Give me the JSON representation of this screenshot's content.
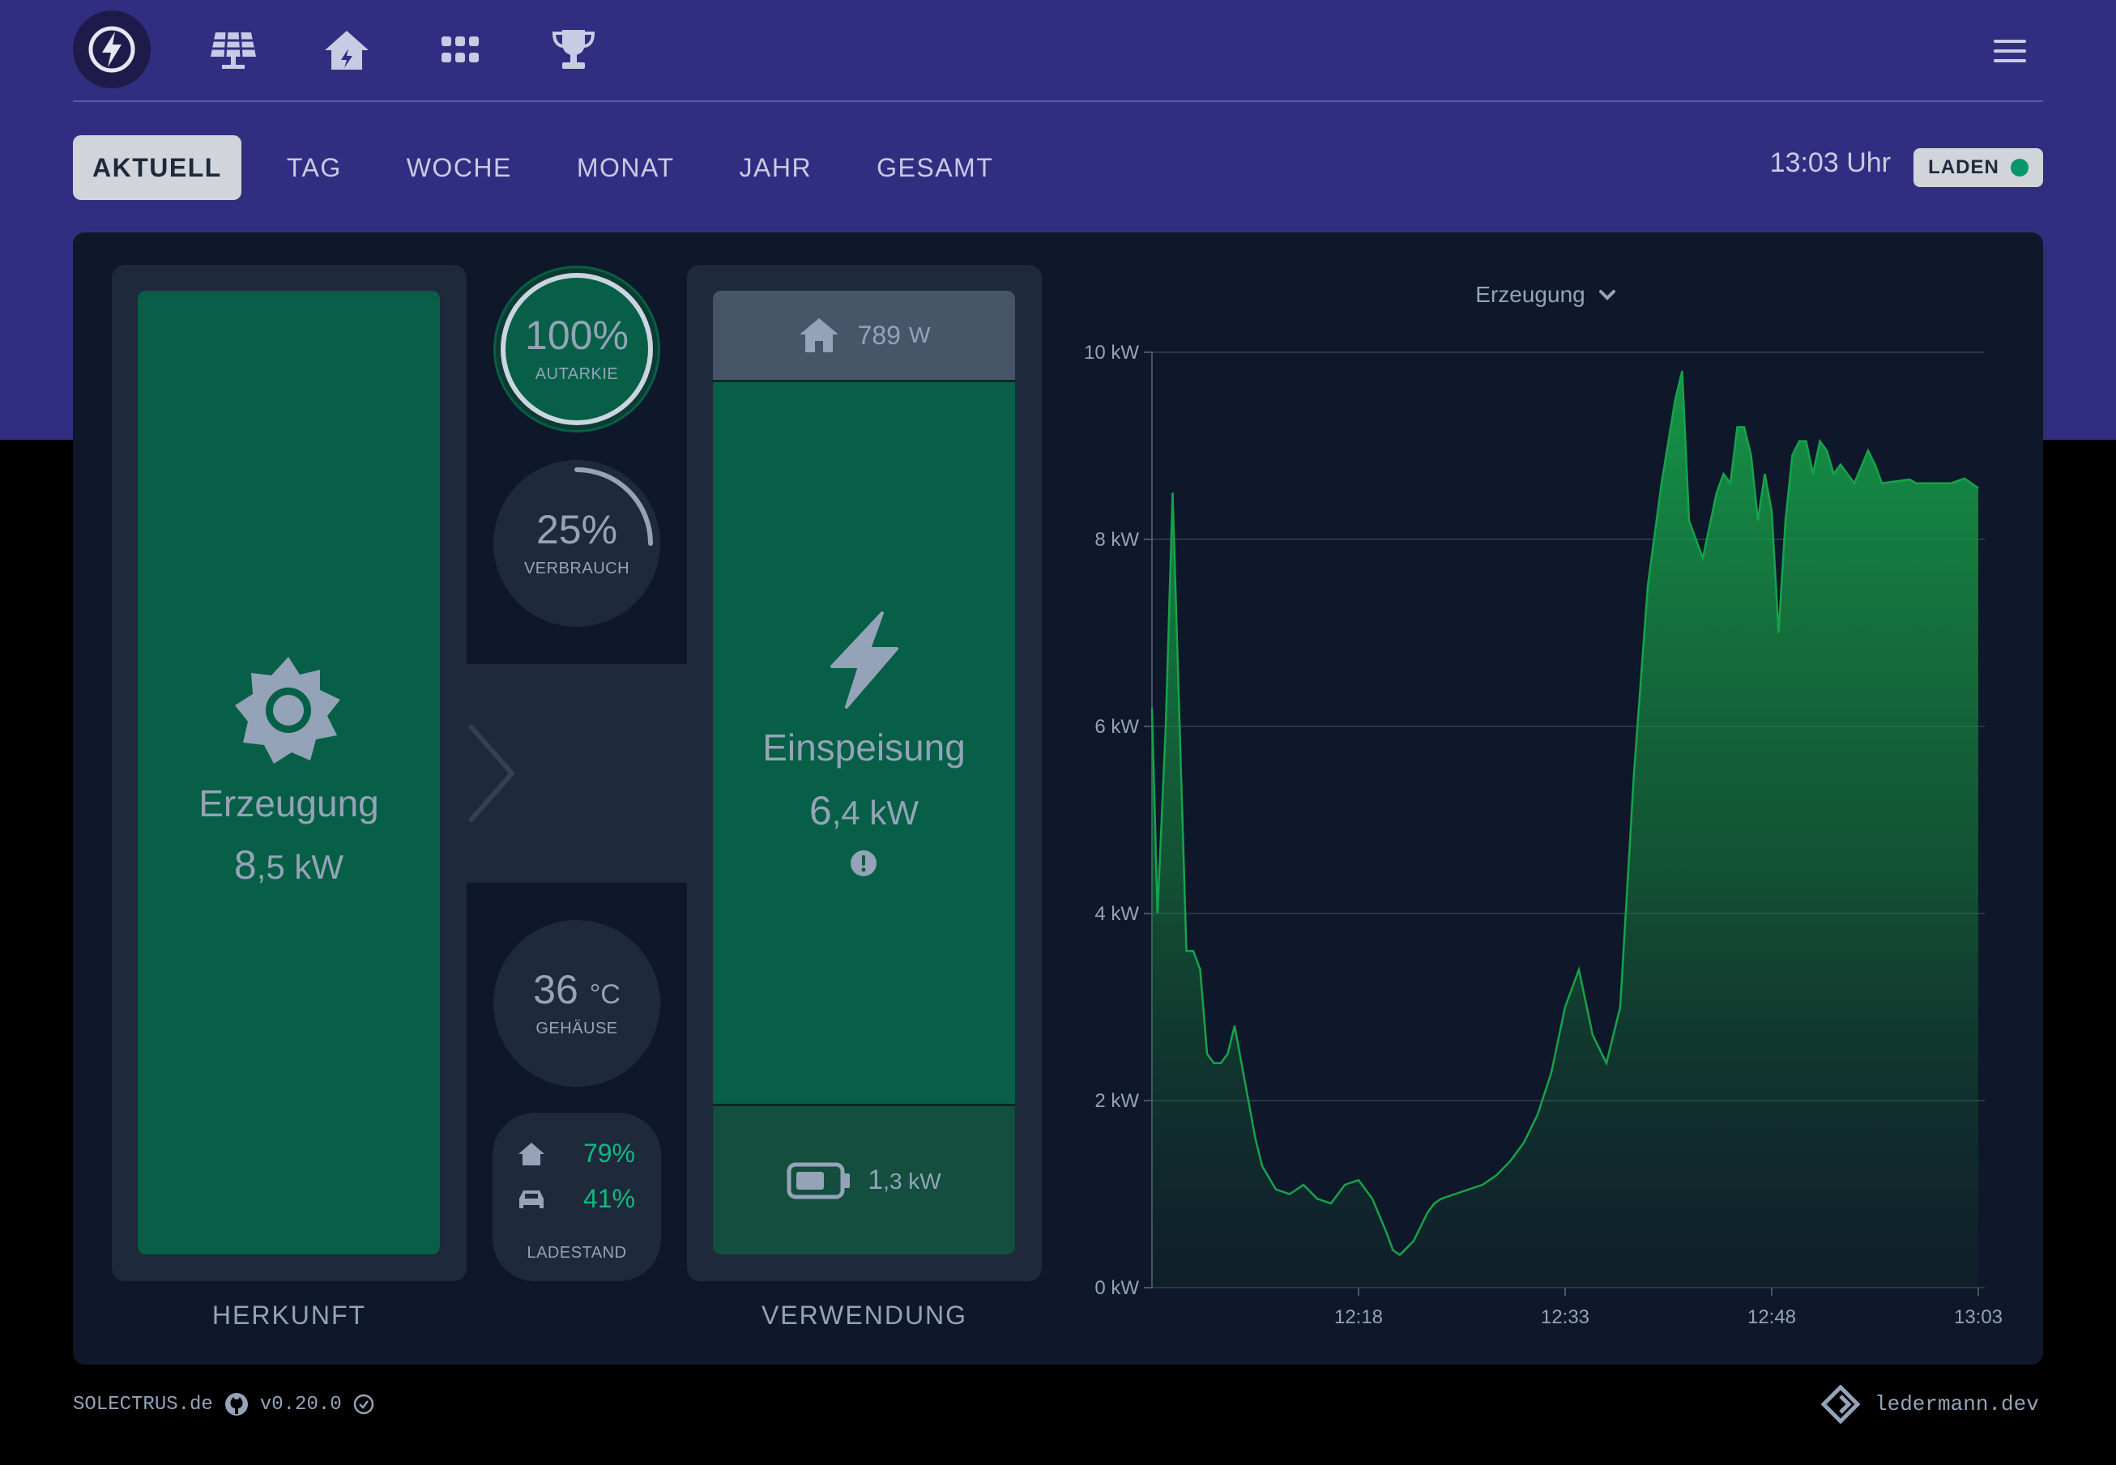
{
  "header": {
    "logo_icon": "lightning-bolt-logo",
    "nav_icons": [
      "solar-panel-icon",
      "house-icon",
      "grid-icon",
      "trophy-icon"
    ],
    "menu_icon": "hamburger-menu-icon"
  },
  "tabs": [
    {
      "label": "AKTUELL",
      "active": true
    },
    {
      "label": "TAG",
      "active": false
    },
    {
      "label": "WOCHE",
      "active": false
    },
    {
      "label": "MONAT",
      "active": false
    },
    {
      "label": "JAHR",
      "active": false
    },
    {
      "label": "GESAMT",
      "active": false
    }
  ],
  "status": {
    "time": "13:03 Uhr",
    "badge": "LADEN",
    "badge_color": "#059669"
  },
  "origin": {
    "icon": "sun-icon",
    "label": "Erzeugung",
    "value_int": "8",
    "value_frac": ",5 kW",
    "column_label": "HERKUNFT"
  },
  "gauges": {
    "autarkie": {
      "value": "100%",
      "label": "AUTARKIE",
      "fraction": 1.0
    },
    "verbrauch": {
      "value": "25%",
      "label": "VERBRAUCH",
      "fraction": 0.25
    },
    "gehaeuse": {
      "value": "36",
      "unit": "°C",
      "label": "GEHÄUSE"
    },
    "ladestand": {
      "house_icon": "house-icon",
      "house_pct": "79%",
      "car_icon": "car-icon",
      "car_pct": "41%",
      "label": "LADESTAND"
    }
  },
  "usage": {
    "house": {
      "icon": "house-icon",
      "value": "789",
      "unit": "W"
    },
    "feed": {
      "icon": "lightning-icon",
      "label": "Einspeisung",
      "value_int": "6",
      "value_frac": ",4 kW",
      "warning_icon": "exclamation-circle-icon"
    },
    "battery": {
      "icon": "battery-icon",
      "value_int": "1",
      "value_frac": ",3 kW"
    },
    "column_label": "VERWENDUNG"
  },
  "chart_selector": {
    "label": "Erzeugung",
    "icon": "chevron-down-icon"
  },
  "chart_data": {
    "type": "area",
    "title": "Erzeugung",
    "xlabel": "",
    "ylabel": "",
    "x_start": "12:03",
    "x_end": "13:03",
    "x_ticks": [
      "12:18",
      "12:33",
      "12:48",
      "13:03"
    ],
    "y_ticks": [
      "0 kW",
      "2 kW",
      "4 kW",
      "6 kW",
      "8 kW",
      "10 kW"
    ],
    "ylim": [
      0,
      10
    ],
    "grid": true,
    "color": "#16a34a",
    "series": [
      {
        "x": [
          0,
          0.4,
          1,
          1.5,
          2.5,
          3,
          3.5,
          4,
          4.5,
          5,
          5.5,
          6,
          7,
          7.5,
          8,
          9,
          10,
          11,
          12,
          13,
          13.5,
          14,
          15,
          16,
          17,
          17.5,
          18,
          19,
          20,
          20.5,
          21,
          22,
          23,
          24,
          25,
          26,
          27,
          28,
          29,
          30,
          31,
          32,
          33,
          34,
          35,
          36,
          37,
          38,
          38.5,
          39,
          40,
          41,
          41.5,
          42,
          42.5,
          43,
          43.5,
          44,
          44.5,
          45,
          45.5,
          46,
          46.5,
          47,
          47.5,
          48,
          48.5,
          49,
          49.5,
          50,
          51,
          52,
          52.5,
          53,
          54,
          55,
          55.5,
          56,
          57,
          58,
          59,
          60
        ],
        "y": [
          6.2,
          4.0,
          6.0,
          8.5,
          3.6,
          3.6,
          3.4,
          2.5,
          2.4,
          2.4,
          2.5,
          2.8,
          2.0,
          1.6,
          1.3,
          1.05,
          1.0,
          1.1,
          0.95,
          0.9,
          1.0,
          1.1,
          1.15,
          0.95,
          0.6,
          0.4,
          0.35,
          0.5,
          0.8,
          0.9,
          0.95,
          1.0,
          1.05,
          1.1,
          1.2,
          1.35,
          1.55,
          1.85,
          2.3,
          3.0,
          3.4,
          2.7,
          2.4,
          3.0,
          5.5,
          7.5,
          8.6,
          9.5,
          9.8,
          8.2,
          7.8,
          8.5,
          8.7,
          8.6,
          9.2,
          9.2,
          8.9,
          8.2,
          8.7,
          8.3,
          7.0,
          8.2,
          8.9,
          9.05,
          9.05,
          8.7,
          9.05,
          8.95,
          8.7,
          8.8,
          8.6,
          8.95,
          8.8,
          8.6,
          8.62,
          8.64,
          8.6,
          8.6,
          8.6,
          8.6,
          8.65,
          8.55
        ]
      }
    ]
  },
  "footer": {
    "brand": "SOLECTRUS.de",
    "github_icon": "github-icon",
    "version": "v0.20.0",
    "check_icon": "check-circle-icon",
    "author_icon": "ledermann-logo-icon",
    "author": "ledermann.dev"
  }
}
